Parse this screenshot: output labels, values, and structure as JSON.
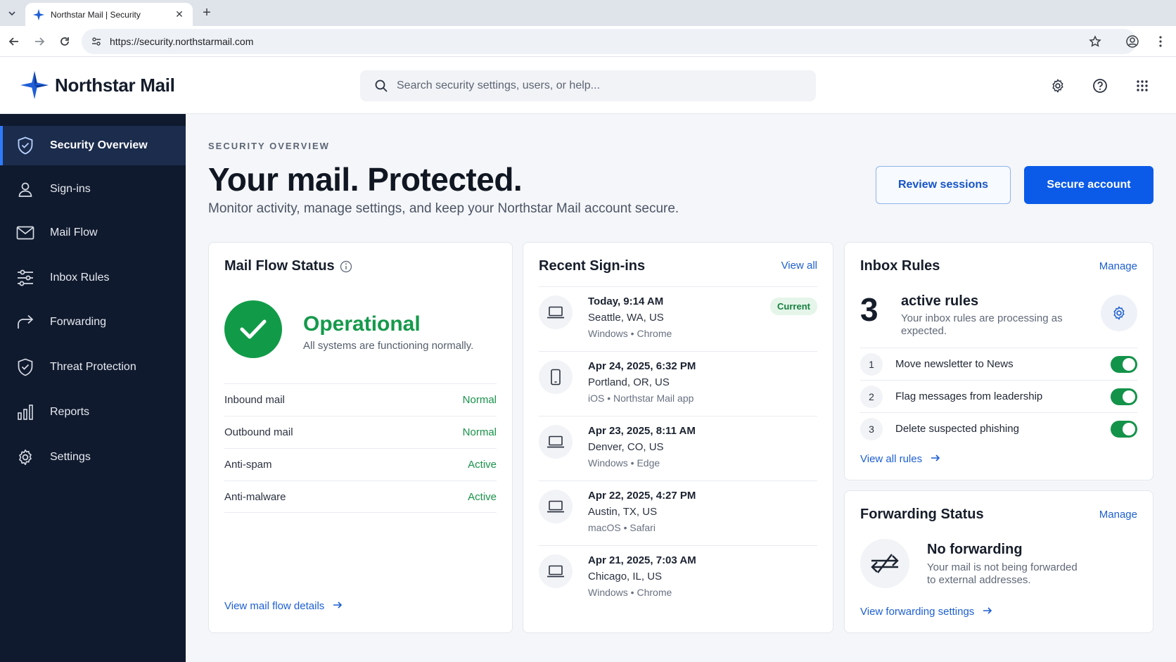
{
  "browser": {
    "tab_title": "Northstar Mail | Security",
    "url": "https://security.northstarmail.com"
  },
  "header": {
    "brand": "Northstar Mail",
    "search_placeholder": "Search security settings, users, or help..."
  },
  "sidebar": {
    "items": [
      {
        "label": "Security Overview",
        "icon": "shield-icon",
        "active": true
      },
      {
        "label": "Sign-ins",
        "icon": "user-icon"
      },
      {
        "label": "Mail Flow",
        "icon": "mail-icon"
      },
      {
        "label": "Inbox Rules",
        "icon": "sliders-icon"
      },
      {
        "label": "Forwarding",
        "icon": "forward-arrow-icon"
      },
      {
        "label": "Threat Protection",
        "icon": "shield-check-icon"
      },
      {
        "label": "Reports",
        "icon": "bar-chart-icon"
      },
      {
        "label": "Settings",
        "icon": "gear-icon"
      }
    ]
  },
  "main": {
    "eyebrow": "SECURITY OVERVIEW",
    "title": "Your mail. Protected.",
    "subtitle": "Monitor activity, manage settings, and keep your Northstar Mail account secure.",
    "review_button": "Review sessions",
    "secure_button": "Secure account"
  },
  "mail_flow": {
    "title": "Mail Flow Status",
    "status": "Operational",
    "status_desc": "All systems are functioning normally.",
    "rows": [
      {
        "label": "Inbound mail",
        "value": "Normal"
      },
      {
        "label": "Outbound mail",
        "value": "Normal"
      },
      {
        "label": "Anti-spam",
        "value": "Active"
      },
      {
        "label": "Anti-malware",
        "value": "Active"
      }
    ],
    "link": "View mail flow details"
  },
  "signins": {
    "title": "Recent Sign-ins",
    "view_all": "View all",
    "current_badge": "Current",
    "items": [
      {
        "time": "Today, 9:14 AM",
        "location": "Seattle, WA, US",
        "device": "Windows • Chrome",
        "icon": "laptop-icon"
      },
      {
        "time": "Apr 24, 2025, 6:32 PM",
        "location": "Portland, OR, US",
        "device": "iOS • Northstar Mail app",
        "icon": "phone-icon"
      },
      {
        "time": "Apr 23, 2025, 8:11 AM",
        "location": "Denver, CO, US",
        "device": "Windows • Edge",
        "icon": "laptop-icon"
      },
      {
        "time": "Apr 22, 2025, 4:27 PM",
        "location": "Austin, TX, US",
        "device": "macOS • Safari",
        "icon": "laptop-icon"
      },
      {
        "time": "Apr 21, 2025, 7:03 AM",
        "location": "Chicago, IL, US",
        "device": "Windows • Chrome",
        "icon": "laptop-icon"
      }
    ]
  },
  "inbox_rules": {
    "title": "Inbox Rules",
    "manage": "Manage",
    "count": "3",
    "count_label": "active rules",
    "desc": "Your inbox rules are processing as expected.",
    "rules": [
      {
        "num": "1",
        "name": "Move newsletter to News",
        "enabled": true
      },
      {
        "num": "2",
        "name": "Flag messages from leadership",
        "enabled": true
      },
      {
        "num": "3",
        "name": "Delete suspected phishing",
        "enabled": true
      }
    ],
    "link": "View all rules"
  },
  "forwarding": {
    "title": "Forwarding Status",
    "manage": "Manage",
    "status": "No forwarding",
    "desc": "Your mail is not being forwarded to external addresses.",
    "link": "View forwarding settings"
  },
  "colors": {
    "sidebar_bg": "#0f1a2e",
    "accent": "#0b5be8",
    "success": "#15994b"
  }
}
